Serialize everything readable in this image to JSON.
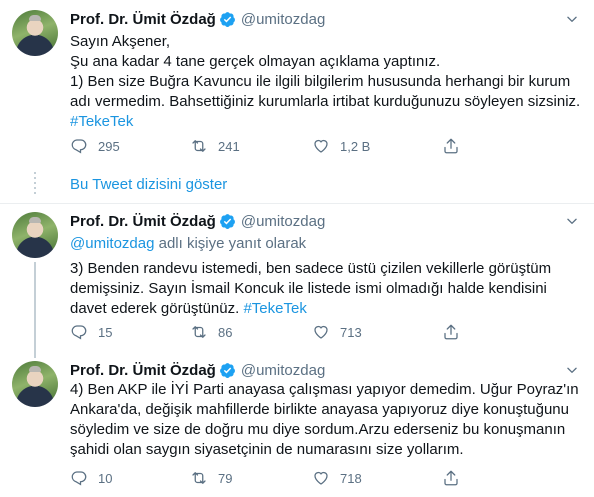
{
  "colors": {
    "link": "#1b95e0",
    "secondary": "#5b7083",
    "verified": "#1da1f2",
    "text": "#0f1419"
  },
  "tweets": [
    {
      "author_name": "Prof. Dr. Ümit Özdağ",
      "handle": "@umitozdag",
      "lines": [
        "Sayın Akşener,",
        "Şu ana kadar 4 tane gerçek olmayan açıklama yaptınız.",
        "1) Ben size Buğra Kavuncu ile ilgili bilgilerim hususunda herhangi bir kurum",
        "adı vermedim. Bahsettiğiniz kurumlarla irtibat kurduğunuzu söyleyen sizsiniz."
      ],
      "hashtag": "#TekeTek",
      "reply_count": "295",
      "retweet_count": "241",
      "like_count": "1,2 B"
    },
    {
      "author_name": "Prof. Dr. Ümit Özdağ",
      "handle": "@umitozdag",
      "reply_mention": "@umitozdag",
      "reply_suffix": " adlı kişiye yanıt olarak",
      "lines": [
        "3) Benden randevu istemedi, ben sadece üstü çizilen vekillerle görüştüm",
        "demişsiniz. Sayın İsmail Koncuk ile listede ismi olmadığı halde kendisini"
      ],
      "last_line_prefix": "davet ederek görüştünüz. ",
      "hashtag": "#TekeTek",
      "reply_count": "15",
      "retweet_count": "86",
      "like_count": "713"
    },
    {
      "author_name": "Prof. Dr. Ümit Özdağ",
      "handle": "@umitozdag",
      "lines": [
        "4) Ben AKP ile İYİ Parti anayasa çalışması yapıyor demedim. Uğur Poyraz'ın",
        "Ankara'da, değişik mahfillerde birlikte anayasa yapıyoruz diye konuştuğunu",
        "söyledim ve size de doğru mu diye sordum.Arzu ederseniz bu konuşmanın",
        "şahidi olan saygın siyasetçinin de numarasını size yollarım."
      ],
      "reply_count": "10",
      "retweet_count": "79",
      "like_count": "718"
    }
  ],
  "show_thread_label": "Bu Tweet dizisini göster"
}
